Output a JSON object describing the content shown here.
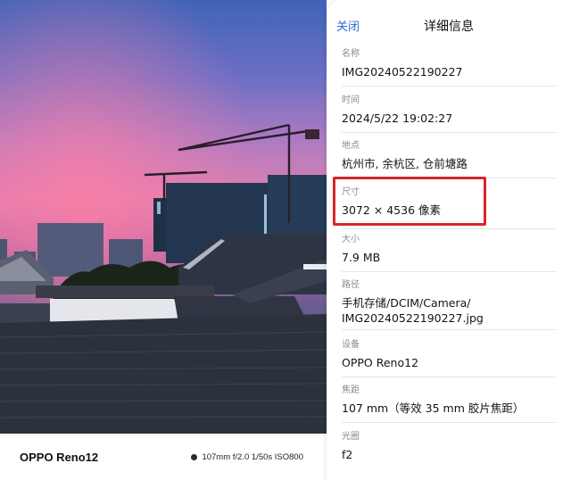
{
  "watermark": {
    "device": "OPPO Reno12",
    "params": "107mm  f/2.0  1/50s  ISO800"
  },
  "details": {
    "close_label": "关闭",
    "title": "详细信息",
    "fields": [
      {
        "label": "名称",
        "value": "IMG20240522190227"
      },
      {
        "label": "时间",
        "value": "2024/5/22 19:02:27"
      },
      {
        "label": "地点",
        "value": "杭州市, 余杭区, 仓前塘路"
      },
      {
        "label": "尺寸",
        "value": "3072 × 4536 像素"
      },
      {
        "label": "大小",
        "value": "7.9 MB"
      },
      {
        "label": "路径",
        "value": "手机存储/DCIM/Camera/",
        "value2": "IMG20240522190227.jpg"
      },
      {
        "label": "设备",
        "value": "OPPO Reno12"
      },
      {
        "label": "焦距",
        "value": "107 mm（等效 35 mm 胶片焦距）"
      },
      {
        "label": "光圈",
        "value": "f2"
      }
    ]
  },
  "colors": {
    "accent": "#2c6bd9",
    "highlight": "#d8262b"
  }
}
